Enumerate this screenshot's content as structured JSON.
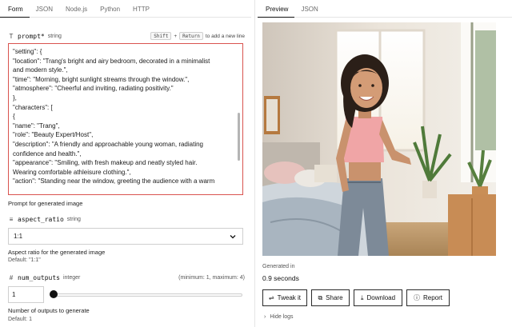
{
  "left_tabs": [
    "Form",
    "JSON",
    "Node.js",
    "Python",
    "HTTP"
  ],
  "right_tabs": [
    "Preview",
    "JSON"
  ],
  "prompt": {
    "name": "prompt",
    "required_mark": "*",
    "type": "string",
    "hint_keys": [
      "Shift",
      "Return"
    ],
    "hint_plus": "+",
    "hint_text": "to add a new line",
    "lines": [
      "\"setting\": {",
      "\"location\": \"Trang's bright and airy bedroom, decorated in a minimalist",
      "and modern style.\",",
      "\"time\": \"Morning, bright sunlight streams through the window.\",",
      "\"atmosphere\": \"Cheerful and inviting, radiating positivity.\"",
      "},",
      "\"characters\": [",
      "{",
      "\"name\": \"Trang\",",
      "\"role\": \"Beauty Expert/Host\",",
      "\"description\": \"A friendly and approachable young woman, radiating",
      "confidence and health.\",",
      "\"appearance\": \"Smiling, with fresh makeup and neatly styled hair.",
      "Wearing comfortable athleisure clothing.\",",
      "\"action\": \"Standing near the window, greeting the audience with a warm"
    ],
    "description": "Prompt for generated image"
  },
  "aspect_ratio": {
    "name": "aspect_ratio",
    "type": "string",
    "value": "1:1",
    "description": "Aspect ratio for the generated image",
    "default": "Default: \"1:1\""
  },
  "num_outputs": {
    "name": "num_outputs",
    "type": "integer",
    "range": "(minimum: 1, maximum: 4)",
    "value": "1",
    "slider_level": 0.0,
    "description": "Number of outputs to generate",
    "default": "Default: 1"
  },
  "preview": {
    "generated_label": "Generated in",
    "generated_value": "0.9 seconds",
    "buttons": [
      {
        "label": "Tweak it",
        "icon": "sliders-icon"
      },
      {
        "label": "Share",
        "icon": "share-icon"
      },
      {
        "label": "Download",
        "icon": "download-icon"
      },
      {
        "label": "Report",
        "icon": "report-icon"
      }
    ],
    "hide_logs": "Hide logs"
  },
  "colors": {
    "error_border": "#d9534f",
    "text": "#1a1a1a",
    "muted": "#555555"
  }
}
